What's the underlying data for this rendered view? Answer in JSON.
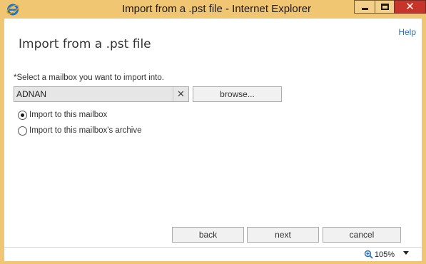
{
  "window": {
    "title": "Import from a .pst file - Internet Explorer",
    "close_glyph": "✕"
  },
  "page": {
    "help_label": "Help",
    "title": "Import from a .pst file",
    "prompt": "*Select a mailbox you want to import into."
  },
  "mailbox": {
    "value": "ADNAN",
    "clear_glyph": "✕",
    "browse_label": "browse..."
  },
  "options": [
    {
      "label": "Import to this mailbox",
      "selected": true
    },
    {
      "label": "Import to this mailbox's archive",
      "selected": false
    }
  ],
  "buttons": {
    "back": "back",
    "next": "next",
    "cancel": "cancel"
  },
  "statusbar": {
    "zoom": "105%"
  },
  "colors": {
    "titlebar": "#f0c673",
    "close_button": "#c7342a",
    "help_link": "#1e74c8"
  }
}
